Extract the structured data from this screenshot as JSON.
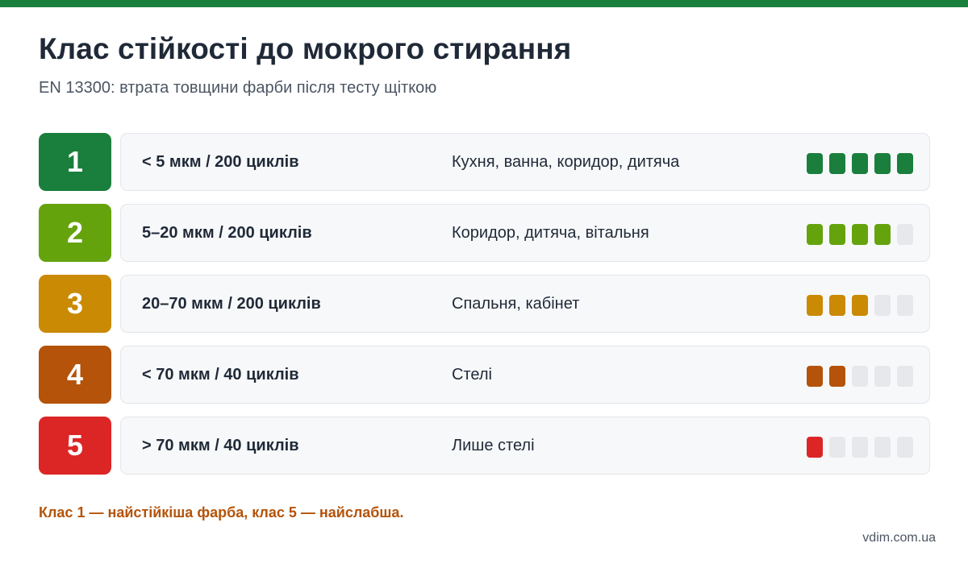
{
  "header": {
    "title": "Клас стійкості до мокрого стирання",
    "subtitle": "EN 13300: втрата товщини фарби після тесту щіткою"
  },
  "classes": [
    {
      "number": "1",
      "metric": "< 5 мкм / 200 циклів",
      "use": "Кухня, ванна, коридор, дитяча",
      "color": "#1a7f3c",
      "level": 5,
      "max_level": 5
    },
    {
      "number": "2",
      "metric": "5–20 мкм / 200 циклів",
      "use": "Коридор, дитяча, вітальня",
      "color": "#65a30d",
      "level": 4,
      "max_level": 5
    },
    {
      "number": "3",
      "metric": "20–70 мкм / 200 циклів",
      "use": "Спальня, кабінет",
      "color": "#ca8a04",
      "level": 3,
      "max_level": 5
    },
    {
      "number": "4",
      "metric": "< 70 мкм / 40 циклів",
      "use": "Стелі",
      "color": "#b45309",
      "level": 2,
      "max_level": 5
    },
    {
      "number": "5",
      "metric": "> 70 мкм / 40 циклів",
      "use": "Лише стелі",
      "color": "#dc2626",
      "level": 1,
      "max_level": 5
    }
  ],
  "footer": {
    "note": "Клас 1 — найстійкіша фарба, клас 5 — найслабша.",
    "site": "vdim.com.ua"
  },
  "colors": {
    "accent": "#1a7f3c",
    "note": "#b45309",
    "empty_block": "#e6e8eb"
  }
}
